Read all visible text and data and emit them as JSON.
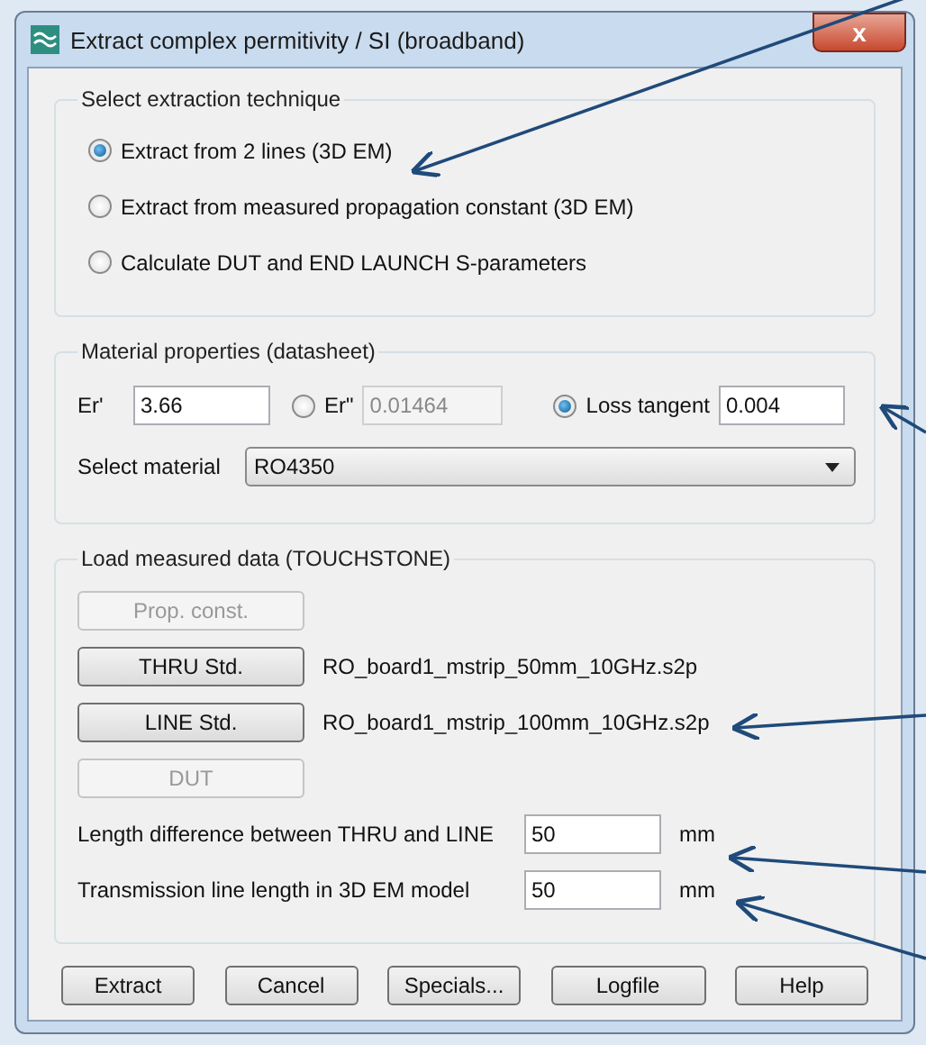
{
  "window": {
    "title": "Extract complex permitivity / SI (broadband)",
    "close": "x"
  },
  "technique": {
    "title": "Select extraction technique",
    "options": [
      {
        "label": "Extract from 2 lines (3D EM)",
        "selected": true
      },
      {
        "label": "Extract from measured propagation constant (3D EM)",
        "selected": false
      },
      {
        "label": "Calculate DUT and END LAUNCH S-parameters",
        "selected": false
      }
    ]
  },
  "material": {
    "title": "Material properties (datasheet)",
    "er_real": {
      "label": "Er'",
      "value": "3.66"
    },
    "er_imag": {
      "label": "Er\"",
      "value": "0.01464",
      "selected": false,
      "disabled": true
    },
    "loss_tangent": {
      "label": "Loss tangent",
      "value": "0.004",
      "selected": true,
      "disabled": false
    },
    "select": {
      "label": "Select material",
      "value": "RO4350"
    }
  },
  "load": {
    "title": "Load measured data (TOUCHSTONE)",
    "files": [
      {
        "button": "Prop. const.",
        "disabled": true
      },
      {
        "button": "THRU Std.",
        "disabled": false,
        "file": "RO_board1_mstrip_50mm_10GHz.s2p"
      },
      {
        "button": "LINE Std.",
        "disabled": false,
        "file": "RO_board1_mstrip_100mm_10GHz.s2p"
      },
      {
        "button": "DUT",
        "disabled": true
      }
    ],
    "lengths": [
      {
        "label": "Length difference between THRU and LINE",
        "value": "50",
        "unit": "mm"
      },
      {
        "label": "Transmission line length in 3D EM model",
        "value": "50",
        "unit": "mm"
      }
    ]
  },
  "buttons": [
    {
      "label": "Extract"
    },
    {
      "label": "Cancel"
    },
    {
      "label": "Specials..."
    },
    {
      "label": "Logfile"
    },
    {
      "label": "Help"
    }
  ]
}
